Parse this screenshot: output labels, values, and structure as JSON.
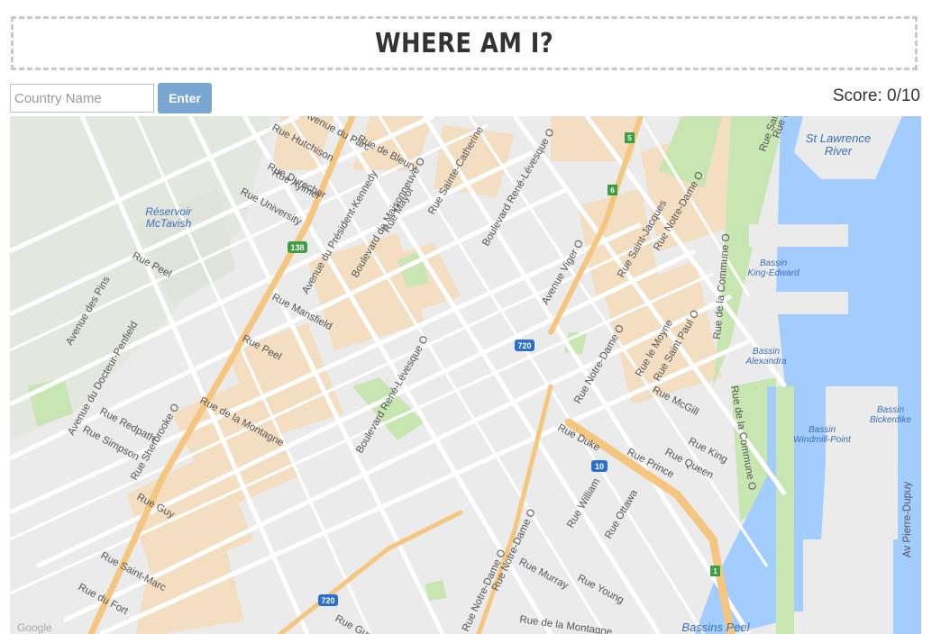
{
  "header": {
    "title": "WHERE AM I?"
  },
  "guess": {
    "placeholder": "Country Name",
    "value": "",
    "button_label": "Enter"
  },
  "score": {
    "label": "Score: ",
    "value": "0/10"
  },
  "map": {
    "attribution": "Google",
    "water_labels": [
      "St Lawrence",
      "River",
      "Bassin",
      "King-Edward",
      "Bassin",
      "Alexandra",
      "Bassin",
      "Windmill-Point",
      "Bassin",
      "Bickerdike",
      "Bassins Peel",
      "Réservoir",
      "McTavish"
    ],
    "route_shields": [
      "138",
      "720",
      "10",
      "720"
    ],
    "exit_markers": [
      "5",
      "6",
      "1"
    ],
    "streets": [
      "Rue Hutchison",
      "Rue Durocher",
      "Rue Aylmer",
      "Rue University",
      "Avenue du Parc",
      "Rue de Bleury",
      "Rue Mayor",
      "Rue Sainte-Catherine",
      "Boulevard René-Lévesque O",
      "Avenue du Président-Kennedy",
      "Boulevard de Maisonneuve O",
      "Rue Peel",
      "Rue Mansfield",
      "Rue Peel",
      "Avenue des Pins",
      "Avenue du Docteur-Penfield",
      "Rue Redpath",
      "Rue Simpson",
      "Rue Sherbrooke O",
      "Rue de la Montagne",
      "Boulevard René-Lévesque O",
      "Rue Guy",
      "Rue Saint-Marc",
      "Rue du Fort",
      "Avenue Viger O",
      "Rue Saint-Jacques",
      "Rue Notre-Dame O",
      "Rue Notre-Dame O",
      "Rue le Moyne",
      "Rue Saint Paul O",
      "Rue de la Commune O",
      "Rue McGill",
      "Rue de la Commune O",
      "Rue Duke",
      "Rue Prince",
      "Rue King",
      "Rue Queen",
      "Rue William",
      "Rue Ottawa",
      "Rue Murray",
      "Rue Young",
      "Rue Notre-Dame O",
      "Rue Notre-Dame O",
      "Rue de la Montagne",
      "Rue Guy",
      "Av Pierre-Dupuy",
      "Rue Saint-Jacques",
      "Rue Notre-Dame O"
    ]
  },
  "colors": {
    "accent": "#7aa7d2",
    "water": "#a3ccff",
    "park": "#c8e6b1",
    "highway": "#f5c680",
    "building": "#f3dec1"
  }
}
